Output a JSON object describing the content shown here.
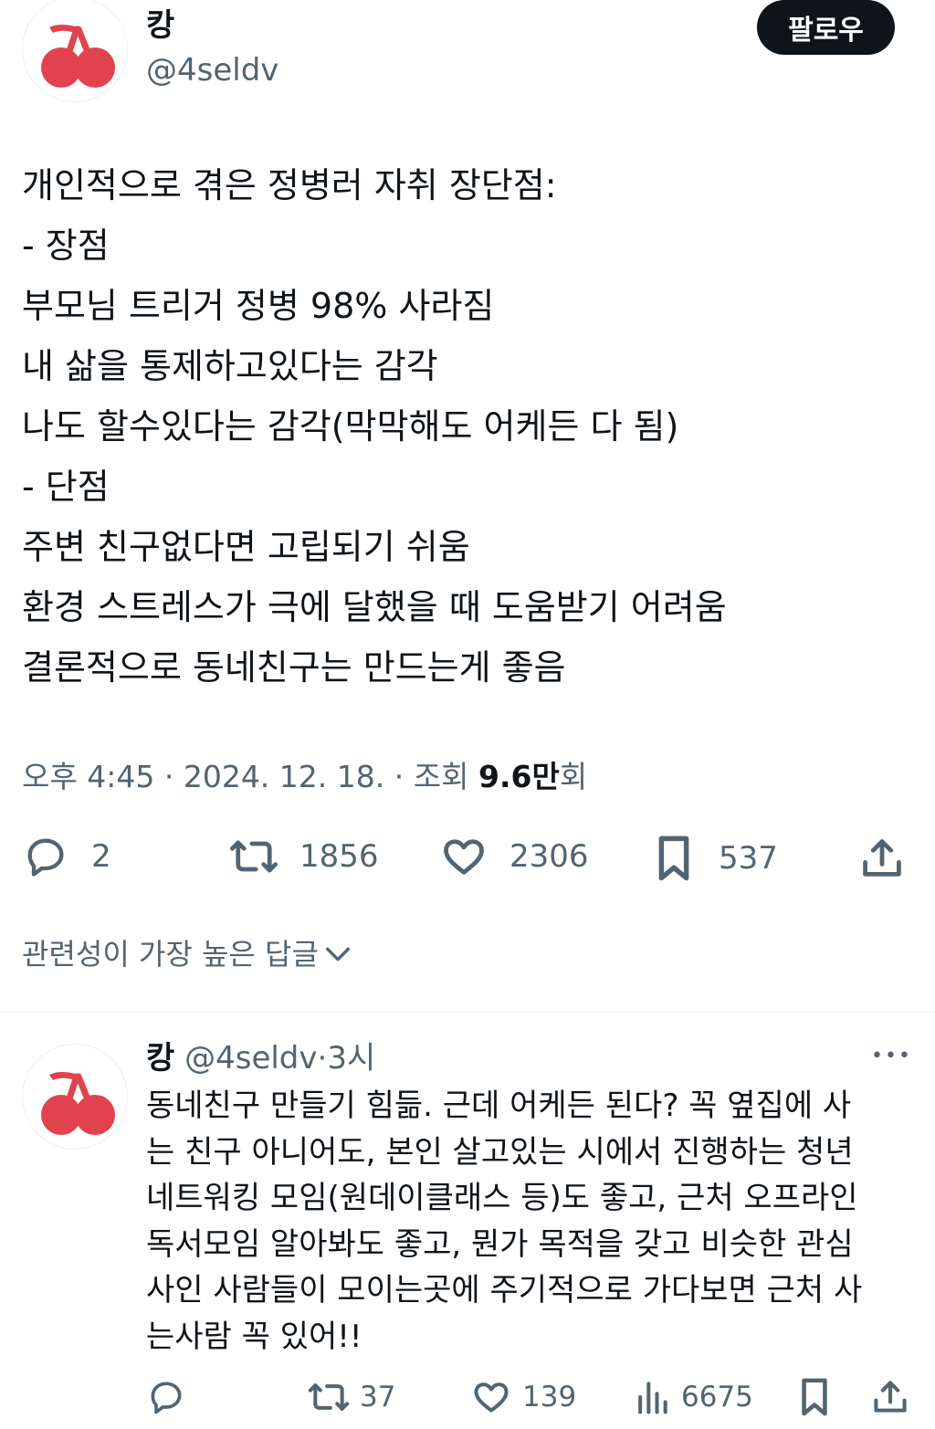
{
  "author": {
    "name": "캉",
    "handle": "@4seldv",
    "follow_label": "팔로우",
    "avatar_icon": "cherry-icon",
    "avatar_color": "#e0434e"
  },
  "post": {
    "lines": [
      "개인적으로 겪은 정병러 자취 장단점:",
      "- 장점",
      "부모님 트리거 정병 98% 사라짐",
      "내 삶을 통제하고있다는 감각",
      "나도 할수있다는 감각(막막해도 어케든 다 됨)",
      "- 단점",
      "주변 친구없다면 고립되기 쉬움",
      "환경 스트레스가 극에 달했을 때 도움받기 어려움",
      "결론적으로 동네친구는 만드는게 좋음"
    ]
  },
  "meta": {
    "time": "오후 4:45",
    "sep": "·",
    "date": "2024. 12. 18.",
    "views_prefix": "조회",
    "views_number": "9.6만",
    "views_suffix": "회"
  },
  "actions": {
    "replies": "2",
    "retweets": "1856",
    "likes": "2306",
    "bookmarks": "537"
  },
  "sort": {
    "label": "관련성이 가장 높은 답글"
  },
  "reply": {
    "name": "캉",
    "handle": "@4seldv",
    "sep": "·",
    "time": "3시",
    "more": "•••",
    "lines": [
      "동네친구 만들기 힘듦. 근데 어케든 된다? 꼭 옆집에 사",
      "는 친구 아니어도, 본인 살고있는 시에서 진행하는 청년",
      "네트워킹 모임(원데이클래스 등)도 좋고, 근처 오프라인",
      "독서모임 알아봐도 좋고, 뭔가 목적을 갖고 비슷한 관심",
      "사인 사람들이 모이는곳에 주기적으로 가다보면 근처 사",
      "는사람 꼭 있어!!"
    ],
    "actions": {
      "replies": "",
      "retweets": "37",
      "likes": "139",
      "views": "6675"
    }
  },
  "colors": {
    "text": "#0f1419",
    "muted": "#536471",
    "divider": "#eff3f4"
  }
}
